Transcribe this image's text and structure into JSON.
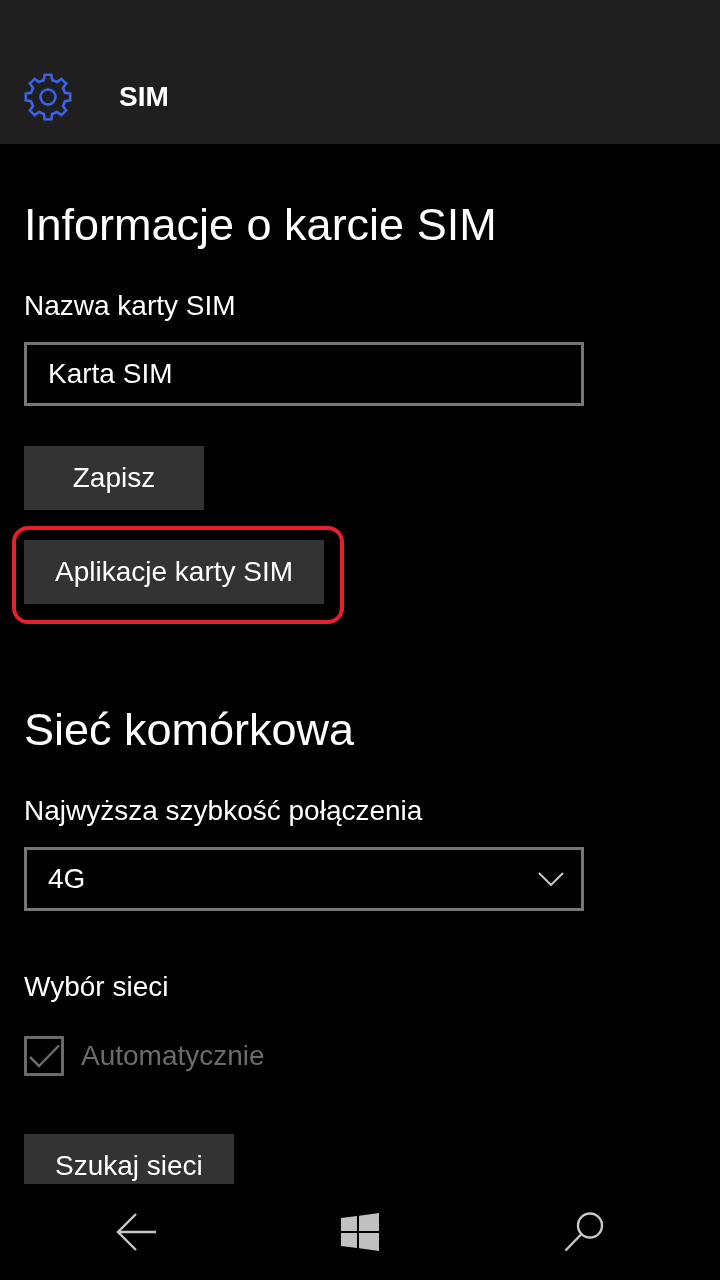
{
  "header": {
    "title": "SIM"
  },
  "sections": [
    {
      "heading": "Informacje o karcie SIM",
      "items": [
        {
          "kind": "field",
          "label": "Nazwa karty SIM",
          "value": "Karta SIM"
        },
        {
          "kind": "button",
          "label": "Zapisz",
          "highlighted": false
        },
        {
          "kind": "button",
          "label": "Aplikacje karty SIM",
          "highlighted": true
        }
      ]
    },
    {
      "heading": "Sieć komórkowa",
      "items": [
        {
          "kind": "dropdown",
          "label": "Najwyższa szybkość połączenia",
          "value": "4G"
        },
        {
          "kind": "checkbox",
          "label": "Wybór sieci",
          "option": "Automatycznie",
          "checked": true,
          "disabled": true
        },
        {
          "kind": "button",
          "label": "Szukaj sieci",
          "highlighted": false
        }
      ]
    }
  ]
}
